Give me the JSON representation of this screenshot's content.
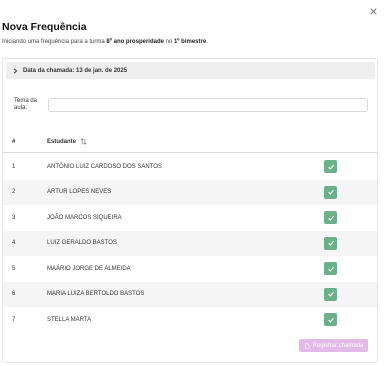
{
  "dialog": {
    "title": "Nova Frequência",
    "subtitle_prefix": "Iniciando uma frequência para a turma ",
    "class_name": "8º ano prosperidade",
    "subtitle_mid": " no ",
    "term": "1º bimestre",
    "subtitle_suffix": ".",
    "close_icon": "close-icon"
  },
  "accordion": {
    "label": "Data da chamada: 13 de jan. de 2025",
    "icon": "chevron-right-icon"
  },
  "topic": {
    "label": "Tema da aula:",
    "value": "",
    "placeholder": ""
  },
  "table": {
    "headers": {
      "number": "#",
      "student": "Estudante"
    },
    "sort_icon": "sort-arrows-icon",
    "rows": [
      {
        "number": "1",
        "name": "ANTÔNIO LUIZ CARDOSO DOS SANTOS",
        "present": true
      },
      {
        "number": "2",
        "name": "ARTUR LOPES NEVES",
        "present": true
      },
      {
        "number": "3",
        "name": "JOÃO MARCOS SIQUEIRA",
        "present": true
      },
      {
        "number": "4",
        "name": "LUIZ GERALDO BASTOS",
        "present": true
      },
      {
        "number": "5",
        "name": "MAÁRIO JORGE DE ALMEIDA",
        "present": true
      },
      {
        "number": "6",
        "name": "MARIA LUIZA BERTOLDO BASTOS",
        "present": true
      },
      {
        "number": "7",
        "name": "STELLA MARTA",
        "present": true
      }
    ]
  },
  "actions": {
    "submit_label": "Registrar chamada",
    "submit_icon": "document-icon"
  },
  "colors": {
    "check_green": "#6ab187",
    "submit_disabled": "#e3b9ea",
    "row_alt": "#f5f5f5",
    "accordion_bg": "#eeeeee"
  }
}
